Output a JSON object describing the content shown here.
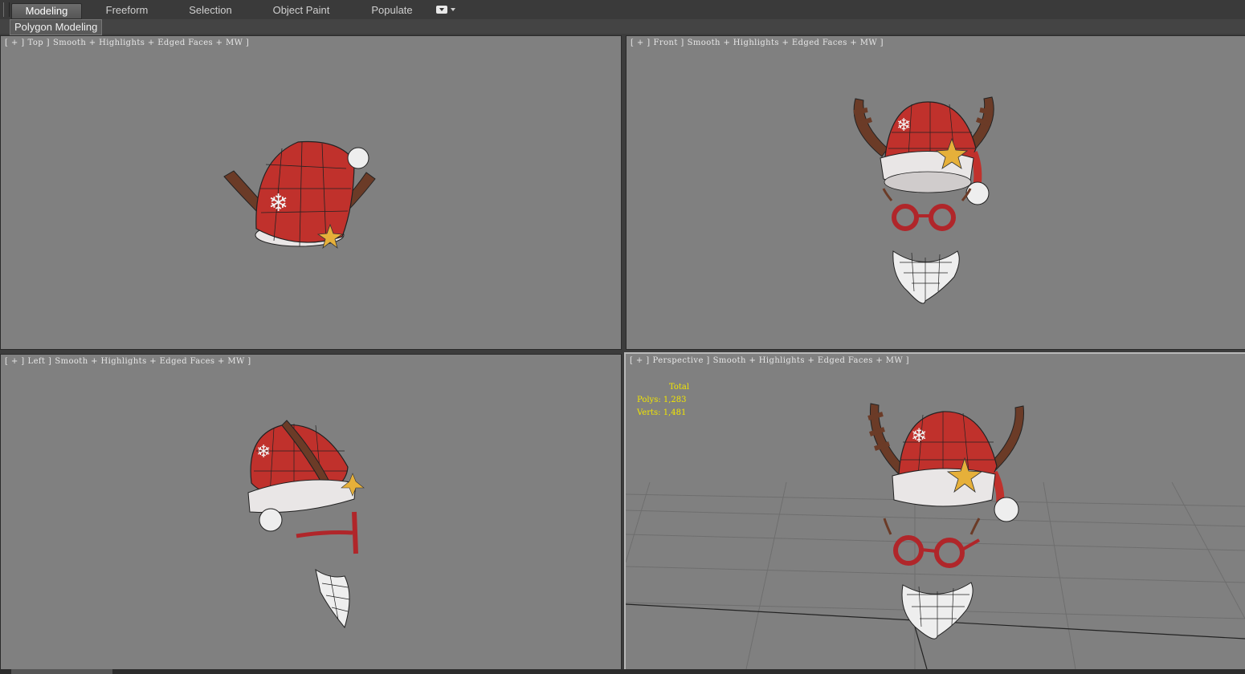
{
  "ribbon": {
    "tabs": [
      "Modeling",
      "Freeform",
      "Selection",
      "Object Paint",
      "Populate"
    ],
    "active_tab": "Modeling",
    "panel_label": "Polygon Modeling"
  },
  "viewports": {
    "top": {
      "name": "Top",
      "label_parts": [
        "[ + ]",
        "Top ]",
        "Smooth + Highlights + Edged Faces + MW ]"
      ]
    },
    "front": {
      "name": "Front",
      "label_parts": [
        "[ + ]",
        "Front ]",
        "Smooth + Highlights + Edged Faces + MW ]"
      ]
    },
    "left": {
      "name": "Left",
      "label_parts": [
        "[ + ]",
        "Left ]",
        "Smooth + Highlights + Edged Faces + MW ]"
      ]
    },
    "perspective": {
      "name": "Perspective",
      "label_parts": [
        "[ + ]",
        "Perspective ]",
        "Smooth + Highlights + Edged Faces + MW ]"
      ],
      "stats": {
        "title": "Total",
        "polys_label": "Polys:",
        "polys_value": "1,283",
        "verts_label": "Verts:",
        "verts_value": "1,481"
      }
    }
  },
  "colors": {
    "hat_red": "#c0312c",
    "fur_white": "#e9e6e6",
    "antler_brown": "#6b3b27",
    "star_gold": "#e6b03a",
    "stats_yellow": "#f2e600",
    "viewport_gray": "#808080"
  }
}
